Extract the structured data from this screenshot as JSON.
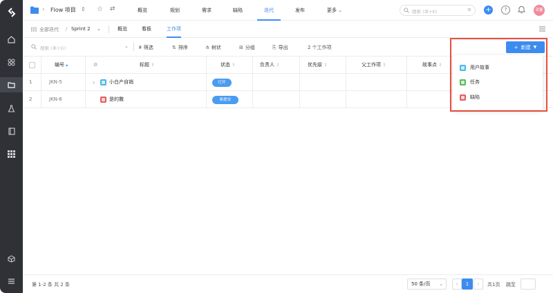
{
  "colors": {
    "accent": "#3c8cf0",
    "rail": "#2f3137",
    "highlight": "#e84c3d",
    "story": "#4bb8e6",
    "task": "#5cb85c",
    "bug": "#e35d5d"
  },
  "rail": {
    "items": [
      "logo-icon",
      "home-icon",
      "apps-icon",
      "folder-icon",
      "flask-icon",
      "book-icon",
      "grid-icon",
      "cube-icon",
      "menu-icon"
    ]
  },
  "topbar": {
    "project_name": "Flow 项目",
    "nav": [
      "概览",
      "规划",
      "需求",
      "缺陷",
      "迭代",
      "发布",
      "更多"
    ],
    "active_nav": "迭代",
    "search_placeholder": "搜索 (⌘+K)",
    "avatar_text": "流量"
  },
  "subbar": {
    "crumb_all": "全部迭代",
    "separator": "/",
    "sprint": "Sprint 2",
    "tabs": [
      "概览",
      "看板",
      "工作项"
    ],
    "active_tab": "工作项"
  },
  "toolbar": {
    "search_placeholder": "搜索 (⌘+G)",
    "filter": "筛选",
    "sort": "排序",
    "tree": "树状",
    "group": "分组",
    "export": "导出",
    "count": "2 个工作项",
    "new_label": "新建"
  },
  "table": {
    "columns": [
      "编号",
      "标题",
      "状态",
      "负责人",
      "优先级",
      "父工作项",
      "故事点"
    ],
    "rows": [
      {
        "index": "1",
        "id": "JKN-5",
        "type": "story",
        "title": "小白产自销",
        "status": "打开",
        "expandable": true
      },
      {
        "index": "2",
        "id": "JKN-6",
        "type": "bug",
        "title": "是的撒",
        "status": "新提交",
        "expandable": false
      }
    ]
  },
  "dropdown": {
    "items": [
      {
        "label": "用户故事",
        "type": "story"
      },
      {
        "label": "任务",
        "type": "task"
      },
      {
        "label": "缺陷",
        "type": "bug"
      }
    ]
  },
  "footer": {
    "total": "第 1-2 条  共 2 条",
    "page_size": "50 条/页",
    "current_page": "1",
    "pages": "共1页",
    "jump_label": "跳至"
  }
}
